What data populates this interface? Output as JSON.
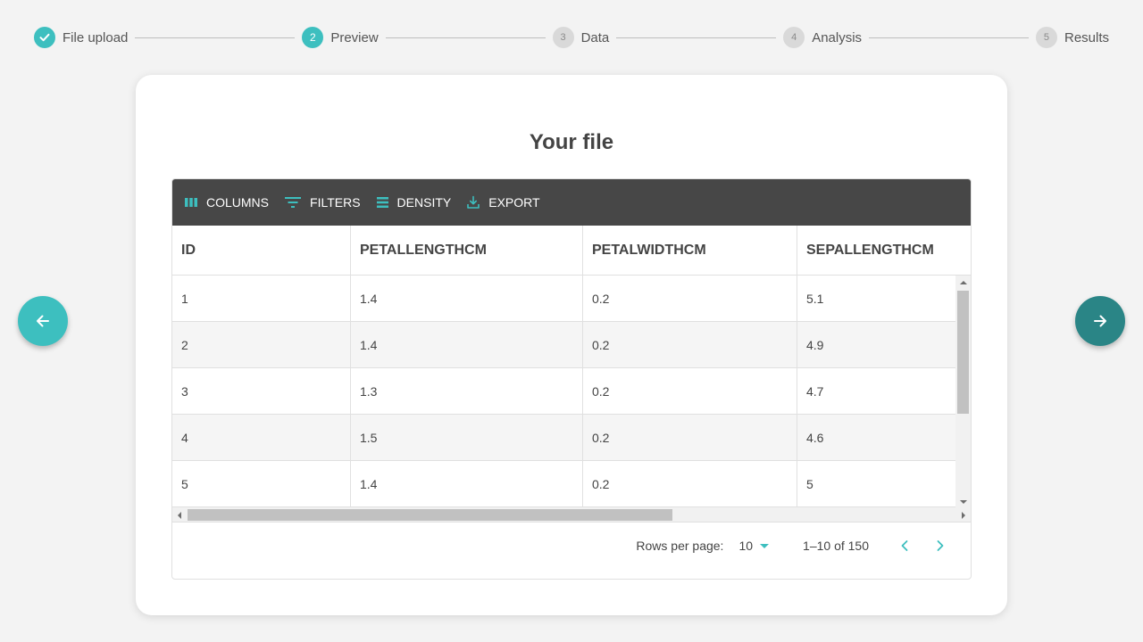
{
  "stepper": {
    "steps": [
      {
        "number": "",
        "label": "File upload",
        "state": "done",
        "icon": "check-icon"
      },
      {
        "number": "2",
        "label": "Preview",
        "state": "active"
      },
      {
        "number": "3",
        "label": "Data",
        "state": "todo"
      },
      {
        "number": "4",
        "label": "Analysis",
        "state": "todo"
      },
      {
        "number": "5",
        "label": "Results",
        "state": "todo"
      }
    ]
  },
  "nav": {
    "prev_icon": "arrow-left-icon",
    "next_icon": "arrow-right-icon"
  },
  "card": {
    "title": "Your file"
  },
  "toolbar": {
    "columns_label": "COLUMNS",
    "filters_label": "FILTERS",
    "density_label": "DENSITY",
    "export_label": "EXPORT"
  },
  "table": {
    "headers": [
      "ID",
      "PETALLENGTHCM",
      "PETALWIDTHCM",
      "SEPALLENGTHCM"
    ],
    "rows": [
      [
        "1",
        "1.4",
        "0.2",
        "5.1"
      ],
      [
        "2",
        "1.4",
        "0.2",
        "4.9"
      ],
      [
        "3",
        "1.3",
        "0.2",
        "4.7"
      ],
      [
        "4",
        "1.5",
        "0.2",
        "4.6"
      ],
      [
        "5",
        "1.4",
        "0.2",
        "5"
      ]
    ]
  },
  "pagination": {
    "rows_per_page_label": "Rows per page:",
    "rows_per_page_value": "10",
    "range_text": "1–10 of 150"
  },
  "colors": {
    "accent": "#3dbfbf",
    "accent_dark": "#2a8586",
    "toolbar_bg": "#474747",
    "step_inactive": "#d9d9d9"
  }
}
